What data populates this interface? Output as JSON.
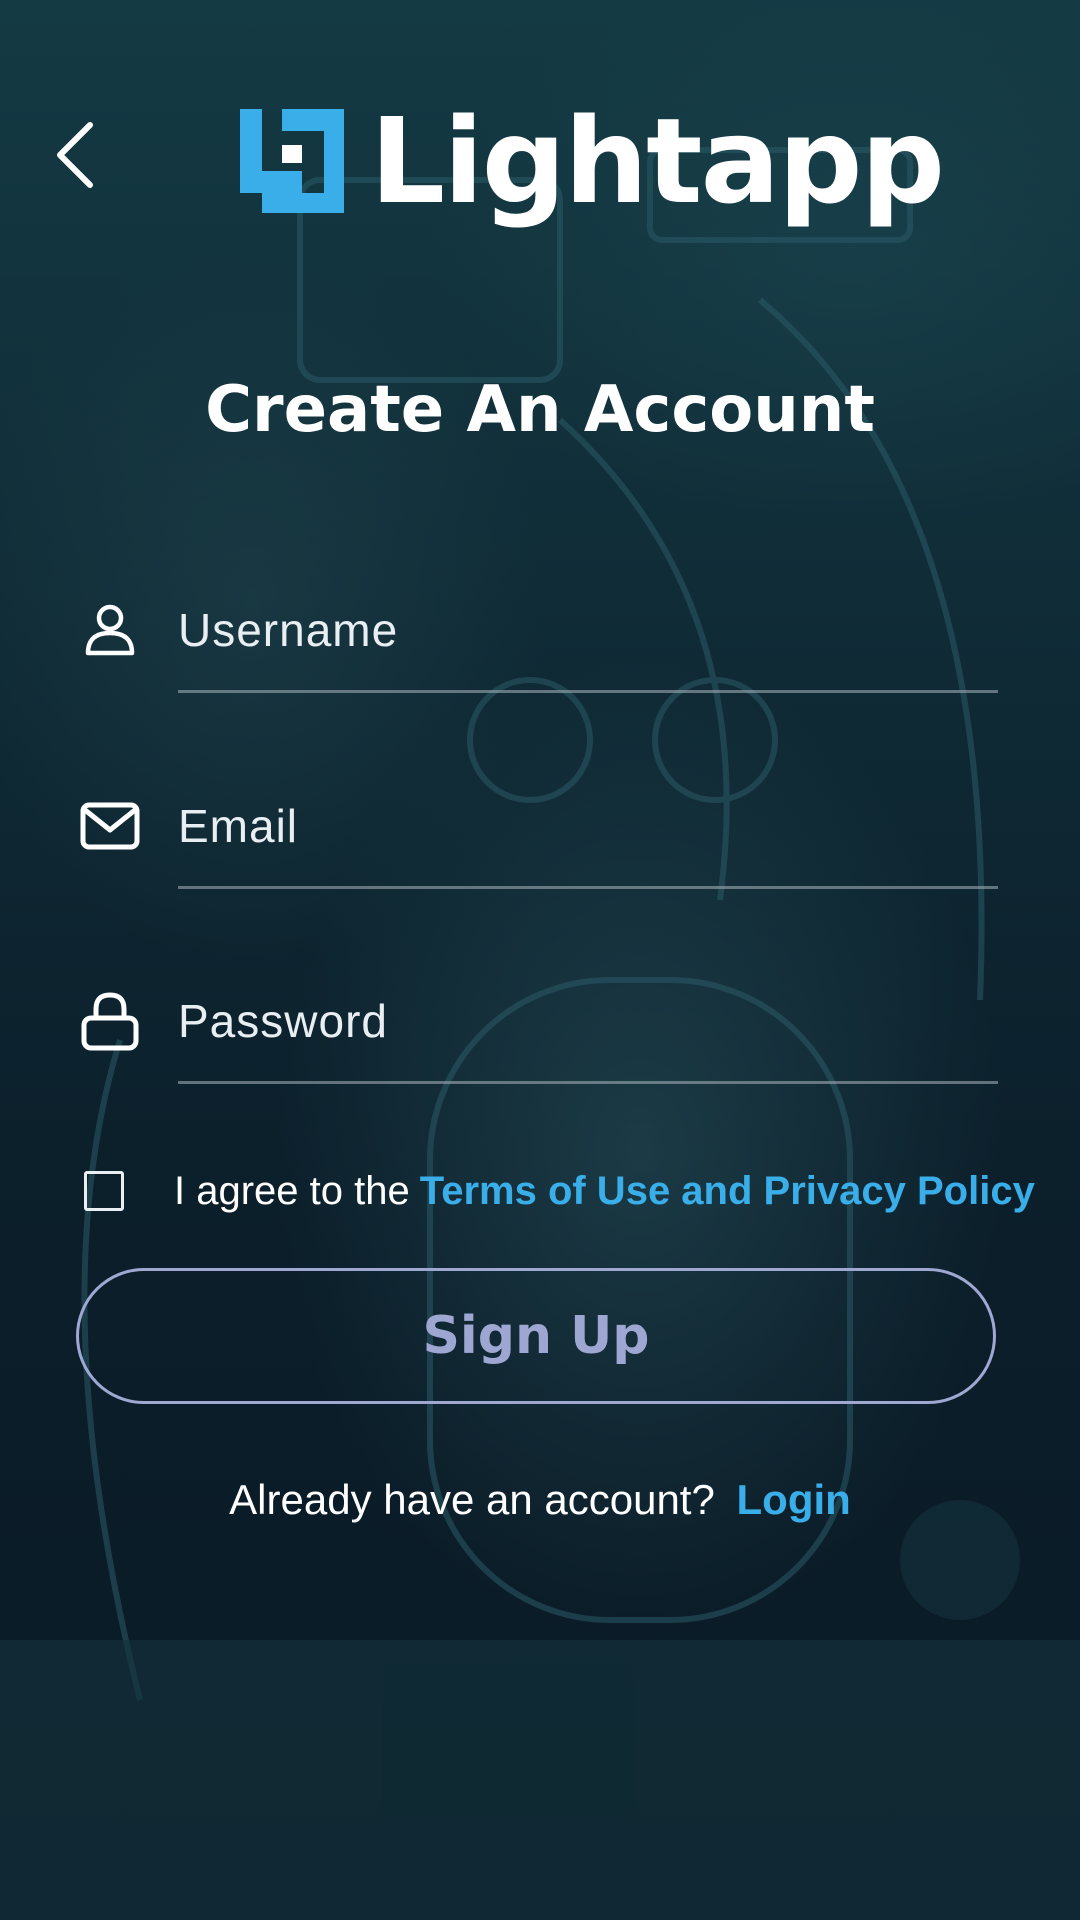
{
  "brand": {
    "name": "Lightapp",
    "accent_color": "#3aaee8"
  },
  "nav": {
    "back_icon": "chevron-left-icon"
  },
  "page": {
    "title": "Create An Account"
  },
  "form": {
    "username": {
      "placeholder": "Username",
      "value": "",
      "icon": "user-icon"
    },
    "email": {
      "placeholder": "Email",
      "value": "",
      "icon": "mail-icon"
    },
    "password": {
      "placeholder": "Password",
      "value": "",
      "icon": "lock-icon"
    },
    "terms": {
      "checked": false,
      "text": "I agree to the",
      "link_label": "Terms of Use and Privacy Policy"
    },
    "submit_label": "Sign Up",
    "submit_color": "#9ea6d2"
  },
  "footer": {
    "prompt": "Already have an account?",
    "login_label": "Login"
  }
}
